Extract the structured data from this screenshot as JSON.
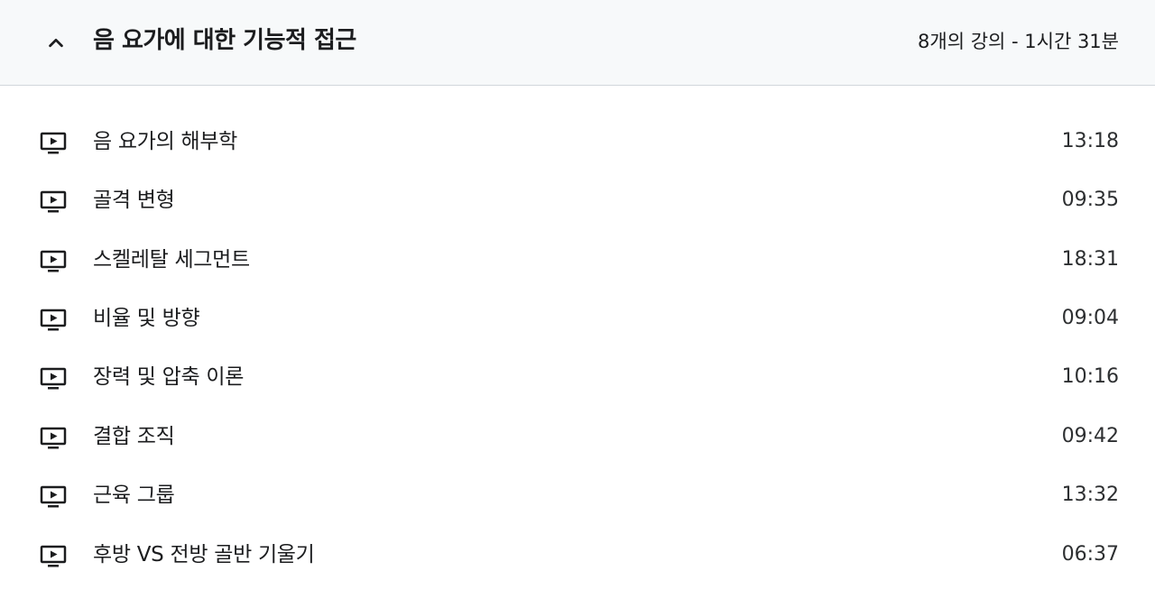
{
  "section": {
    "title": "음 요가에 대한 기능적 접근",
    "meta": "8개의 강의 - 1시간 31분",
    "expanded": true
  },
  "lectures": [
    {
      "title": "음 요가의 해부학",
      "duration": "13:18",
      "icon": "play-video-icon"
    },
    {
      "title": "골격 변형",
      "duration": "09:35",
      "icon": "play-video-icon"
    },
    {
      "title": "스켈레탈 세그먼트",
      "duration": "18:31",
      "icon": "play-video-icon"
    },
    {
      "title": "비율 및 방향",
      "duration": "09:04",
      "icon": "play-video-icon"
    },
    {
      "title": "장력 및 압축 이론",
      "duration": "10:16",
      "icon": "play-video-icon"
    },
    {
      "title": "결합 조직",
      "duration": "09:42",
      "icon": "play-video-icon"
    },
    {
      "title": "근육 그룹",
      "duration": "13:32",
      "icon": "play-video-icon"
    },
    {
      "title": "후방 VS 전방 골반 기울기",
      "duration": "06:37",
      "icon": "play-video-icon"
    }
  ]
}
